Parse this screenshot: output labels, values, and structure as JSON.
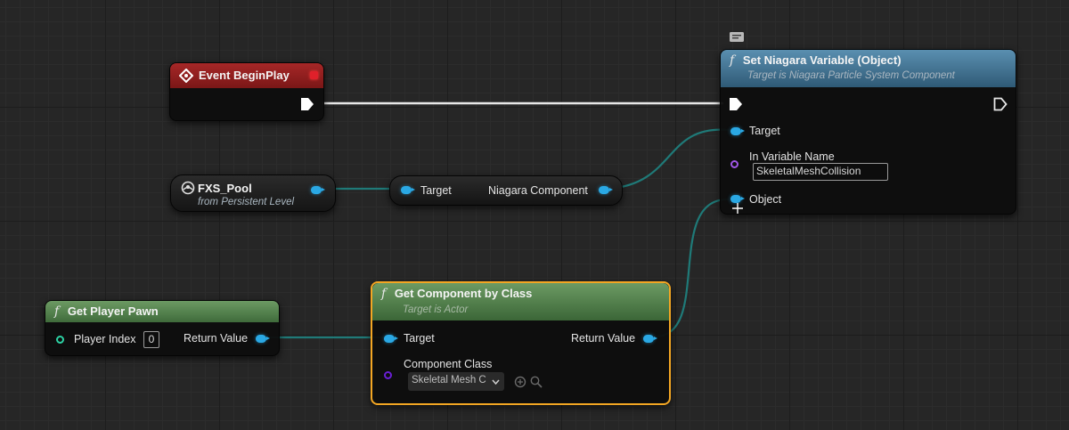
{
  "nodes": {
    "begin_play": {
      "title": "Event BeginPlay"
    },
    "fxs_pool": {
      "title": "FXS_Pool",
      "subtitle": "from Persistent Level"
    },
    "niagara_getter": {
      "target_label": "Target",
      "output_label": "Niagara Component"
    },
    "set_niagara": {
      "title": "Set Niagara Variable (Object)",
      "subtitle": "Target is Niagara Particle System Component",
      "target_label": "Target",
      "var_name_label": "In Variable Name",
      "var_name_value": "SkeletalMeshCollision",
      "object_label": "Object"
    },
    "get_player_pawn": {
      "title": "Get Player Pawn",
      "player_index_label": "Player Index",
      "player_index_value": "0",
      "return_label": "Return Value"
    },
    "get_component": {
      "title": "Get Component by Class",
      "subtitle": "Target is Actor",
      "target_label": "Target",
      "return_label": "Return Value",
      "class_label": "Component Class",
      "class_value": "Skeletal Mesh C"
    }
  },
  "colors": {
    "event_header": "#8f1f1f",
    "function_header_blue": "#3e6f8f",
    "function_header_green": "#4f7a4a",
    "object_pin": "#2aa8e4",
    "selection": "#f3a623",
    "exec_wire": "#e8e8e8",
    "object_wire": "#1f7a78"
  },
  "icons": {
    "event_icon": "event-diamond-icon",
    "function_icon": "function-f-icon",
    "variable_icon": "actor-reference-icon",
    "comment_icon": "comment-bubble-icon"
  }
}
